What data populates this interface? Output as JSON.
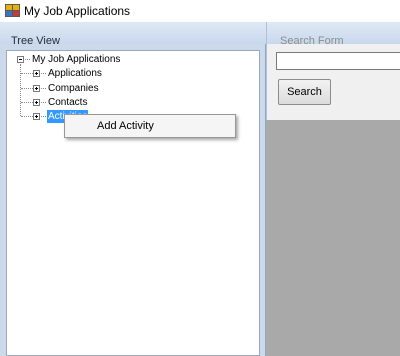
{
  "window": {
    "title": "My Job Applications",
    "icon": "app-icon"
  },
  "tree_panel": {
    "header": "Tree View",
    "root": {
      "label": "My Job Applications",
      "expanded": true,
      "children": [
        {
          "label": "Applications",
          "expanded": false
        },
        {
          "label": "Companies",
          "expanded": false
        },
        {
          "label": "Contacts",
          "expanded": false
        },
        {
          "label": "Activities",
          "expanded": false,
          "selected": true
        }
      ]
    }
  },
  "search_panel": {
    "header": "Search Form",
    "input_value": "",
    "button_label": "Search"
  },
  "context_menu": {
    "items": [
      {
        "label": "Add Activity"
      }
    ]
  },
  "colors": {
    "selection": "#3399ff",
    "panel_header": "#cbd9ea",
    "client_background": "#a9a9a9"
  }
}
